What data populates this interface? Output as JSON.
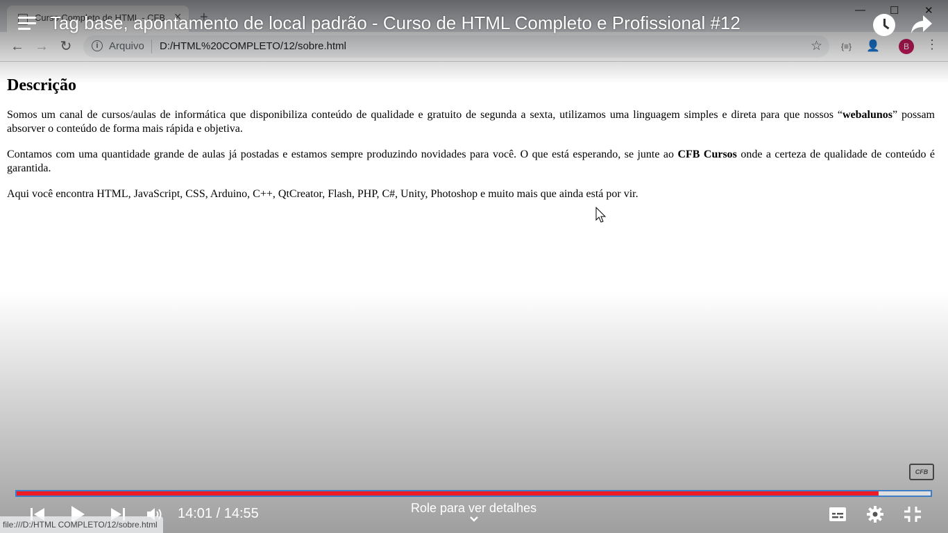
{
  "browser": {
    "tab_title": "Curso Completo de HTML - CFB",
    "address_scheme": "Arquivo",
    "address_url": "D:/HTML%20COMPLETO/12/sobre.html",
    "profile_initial": "B",
    "status_url": "file:///D:/HTML COMPLETO/12/sobre.html"
  },
  "page": {
    "heading": "Descrição",
    "p1_pre": "Somos um canal de cursos/aulas de informática que disponibiliza conteúdo de qualidade e gratuito de segunda a sexta, utilizamos uma linguagem simples e direta para que nossos “",
    "p1_bold": "webalunos",
    "p1_post": "” possam absorver o conteúdo de forma mais rápida e objetiva.",
    "p2_pre": "Contamos com uma quantidade grande de aulas já postadas e estamos sempre produzindo novidades para você. O que está esperando, se junte ao ",
    "p2_bold": "CFB Cursos",
    "p2_post": " onde a certeza de qualidade de conteúdo é garantida.",
    "p3": "Aqui você encontra HTML, JavaScript, CSS, Arduino, C++, QtCreator, Flash, PHP, C#, Unity, Photoshop e muito mais que ainda está por vir."
  },
  "video": {
    "title": "Tag base, apontamento de local padrão - Curso de HTML Completo e Profissional #12",
    "time_display": "14:01 / 14:55",
    "progress_fraction": 0.943,
    "scroll_hint": "Role para ver detalhes",
    "watermark": "CFB"
  },
  "colors": {
    "progress_fill": "#ee1c25",
    "progress_border": "#3d7ec6",
    "profile": "#c2185b"
  }
}
